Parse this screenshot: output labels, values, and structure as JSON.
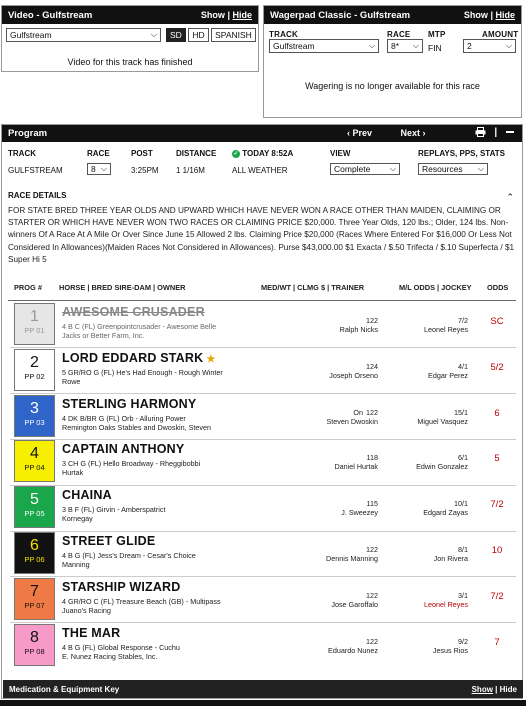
{
  "video": {
    "title": "Video - Gulfstream",
    "show": "Show",
    "sep": "|",
    "hide": "Hide",
    "track_value": "Gulfstream",
    "btn_sd": "SD",
    "btn_hd": "HD",
    "btn_spanish": "SPANISH",
    "message": "Video for this track has finished"
  },
  "wagerpad": {
    "title": "Wagerpad Classic - Gulfstream",
    "show": "Show",
    "sep": "|",
    "hide": "Hide",
    "track_label": "TRACK",
    "track_value": "Gulfstream",
    "race_label": "RACE",
    "race_value": "8*",
    "mtp_label": "MTP",
    "mtp_value": "FIN",
    "amount_label": "AMOUNT",
    "amount_value": "2",
    "message": "Wagering is no longer available for this race"
  },
  "program": {
    "title": "Program",
    "prev": "‹  Prev",
    "next": "Next  ›",
    "print_icon": "printer-icon",
    "collapse_icon": "minus-icon",
    "track_label": "TRACK",
    "track_value": "GULFSTREAM",
    "race_label": "RACE",
    "race_value": "8",
    "post_label": "POST",
    "post_value": "3:25PM",
    "distance_label": "DISTANCE",
    "distance_value": "1 1/16M",
    "today_label": "TODAY 8:52A",
    "weather_value": "ALL WEATHER",
    "view_label": "VIEW",
    "view_value": "Complete",
    "replays_label": "REPLAYS, PPS, STATS",
    "replays_value": "Resources",
    "details_title": "RACE DETAILS",
    "details_text": "FOR STATE BRED THREE YEAR OLDS AND UPWARD WHICH HAVE NEVER WON A RACE OTHER THAN MAIDEN, CLAIMING OR STARTER OR WHICH HAVE NEVER WON TWO RACES OR CLAIMING PRICE $20,000. Three Year Olds, 120 lbs.; Older, 124 lbs. Non-winners Of A Race At A Mile Or Over Since June 15 Allowed 2 lbs. Claiming Price $20,000 (Races Where Entered For $16,000 Or Less Not Considered In Allowances)(Maiden Races Not Considered in Allowances). Purse $43,000.00 $1 Exacta / $.50 Trifecta / $.10 Superfecta / $1 Super Hi 5",
    "col_prog": "PROG #",
    "col_horse": "HORSE | BRED SIRE-DAM | OWNER",
    "col_med": "MED/WT | CLMG $ | TRAINER",
    "col_ml": "M/L ODDS | JOCKEY",
    "col_odds": "ODDS",
    "horses": [
      {
        "num": "1",
        "pp": "PP 01",
        "name": "AWESOME CRUSADER",
        "breed": "4 B C (FL) Greenpointcrusader - Awesome Belle",
        "owner": "Jacks or Better Farm, Inc.",
        "med": "122",
        "trainer": "Ralph Nicks",
        "ml": "7/2",
        "jockey": "Leonel Reyes",
        "odds": "SC",
        "bg": "#e6e6e6",
        "fg": "#999999",
        "scratched": true,
        "star": false
      },
      {
        "num": "2",
        "pp": "PP 02",
        "name": "LORD EDDARD STARK",
        "breed": "5 GR/RO G (FL) He's Had Enough - Rough Winter",
        "owner": "Rowe",
        "med": "124",
        "trainer": "Joseph Orseno",
        "ml": "4/1",
        "jockey": "Edgar Perez",
        "odds": "5/2",
        "bg": "#ffffff",
        "fg": "#111111",
        "scratched": false,
        "star": true
      },
      {
        "num": "3",
        "pp": "PP 03",
        "name": "STERLING HARMONY",
        "breed": "4 DK B/BR G (FL) Orb - Alluring Power",
        "owner": "Remington Oaks Stables and Dwoskin, Steven",
        "med_top": "On",
        "med": "122",
        "trainer": "Steven Dwoskin",
        "ml": "15/1",
        "jockey": "Miguel Vasquez",
        "odds": "6",
        "bg": "#2f64c8",
        "fg": "#ffffff",
        "scratched": false,
        "star": false
      },
      {
        "num": "4",
        "pp": "PP 04",
        "name": "CAPTAIN ANTHONY",
        "breed": "3 CH G (FL) Hello Broadway - Rheggibobbi",
        "owner": "Hurtak",
        "med": "118",
        "trainer": "Daniel Hurtak",
        "ml": "6/1",
        "jockey": "Edwin Gonzalez",
        "odds": "5",
        "bg": "#f6f000",
        "fg": "#111111",
        "scratched": false,
        "star": false
      },
      {
        "num": "5",
        "pp": "PP 05",
        "name": "CHAINA",
        "breed": "3 B F (FL) Girvin - Amberspatrict",
        "owner": "Kornegay",
        "med": "115",
        "trainer": "J. Sweezey",
        "ml": "10/1",
        "jockey": "Edgard Zayas",
        "odds": "7/2",
        "bg": "#1aa64a",
        "fg": "#ffffff",
        "scratched": false,
        "star": false
      },
      {
        "num": "6",
        "pp": "PP 06",
        "name": "STREET GLIDE",
        "breed": "4 B G (FL) Jess's Dream - Cesar's Choice",
        "owner": "Manning",
        "med": "122",
        "trainer": "Dennis Manning",
        "ml": "8/1",
        "jockey": "Jon Rivera",
        "odds": "10",
        "bg": "#111111",
        "fg": "#f6e000",
        "scratched": false,
        "star": false
      },
      {
        "num": "7",
        "pp": "PP 07",
        "name": "STARSHIP WIZARD",
        "breed": "4 GR/RO C (FL) Treasure Beach (GB) - Multipass",
        "owner": "Juano's Racing",
        "med": "122",
        "trainer": "Jose Garoffalo",
        "ml": "3/1",
        "jockey": "Leonel Reyes",
        "jockey_red": true,
        "odds": "7/2",
        "bg": "#f07a45",
        "fg": "#111111",
        "scratched": false,
        "star": false
      },
      {
        "num": "8",
        "pp": "PP 08",
        "name": "THE MAR",
        "breed": "4 B G (FL) Global Response - Cuchu",
        "owner": "E. Nunez Racing Stables, Inc.",
        "med": "122",
        "trainer": "Eduardo Nunez",
        "ml": "9/2",
        "jockey": "Jesus Rios",
        "odds": "7",
        "bg": "#f79ac8",
        "fg": "#111111",
        "scratched": false,
        "star": false
      }
    ]
  },
  "footer": {
    "label": "Medication & Equipment Key",
    "show": "Show",
    "sep": "|",
    "hide": "Hide"
  }
}
